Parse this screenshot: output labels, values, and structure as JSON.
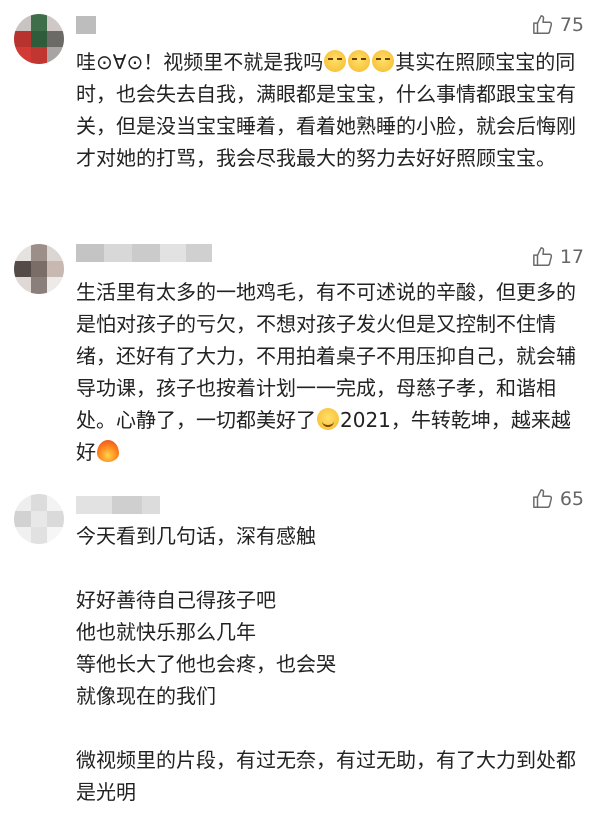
{
  "comments": [
    {
      "likes": "75",
      "text_parts": [
        "哇⊙∀⊙！视频里不就是我吗",
        "其实在照顾宝宝的同时，也会失去自我，满眼都是宝宝，什么事情都跟宝宝有关，但是没当宝宝睡着，看着她熟睡的小脸，就会后悔刚才对她的打骂，我会尽我最大的努力去好好照顾宝宝。"
      ],
      "emoji": [
        "smirk-emoji",
        "smirk-emoji",
        "smirk-emoji"
      ]
    },
    {
      "likes": "17",
      "text_parts": [
        "生活里有太多的一地鸡毛，有不可述说的辛酸，但更多的是怕对孩子的亏欠，不想对孩子发火但是又控制不住情绪，还好有了大力，不用拍着桌子不用压抑自己，就会辅导功课，孩子也按着计划一一完成，母慈子孝，和谐相处。心静了，一切都美好了",
        "2021，牛转乾坤，越来越好"
      ],
      "emoji": [
        "smile-emoji",
        "fire-emoji"
      ]
    },
    {
      "likes": "65",
      "text": "今天看到几句话，深有感触\n\n好好善待自己得孩子吧\n他也就快乐那么几年\n等他长大了他也会疼，也会哭\n就像现在的我们\n\n微视频里的片段，有过无奈，有过无助，有了大力到处都是光明"
    }
  ],
  "colors": {
    "text": "#222222",
    "meta": "#666666"
  },
  "icons": {
    "like": "thumbs-up-icon"
  }
}
